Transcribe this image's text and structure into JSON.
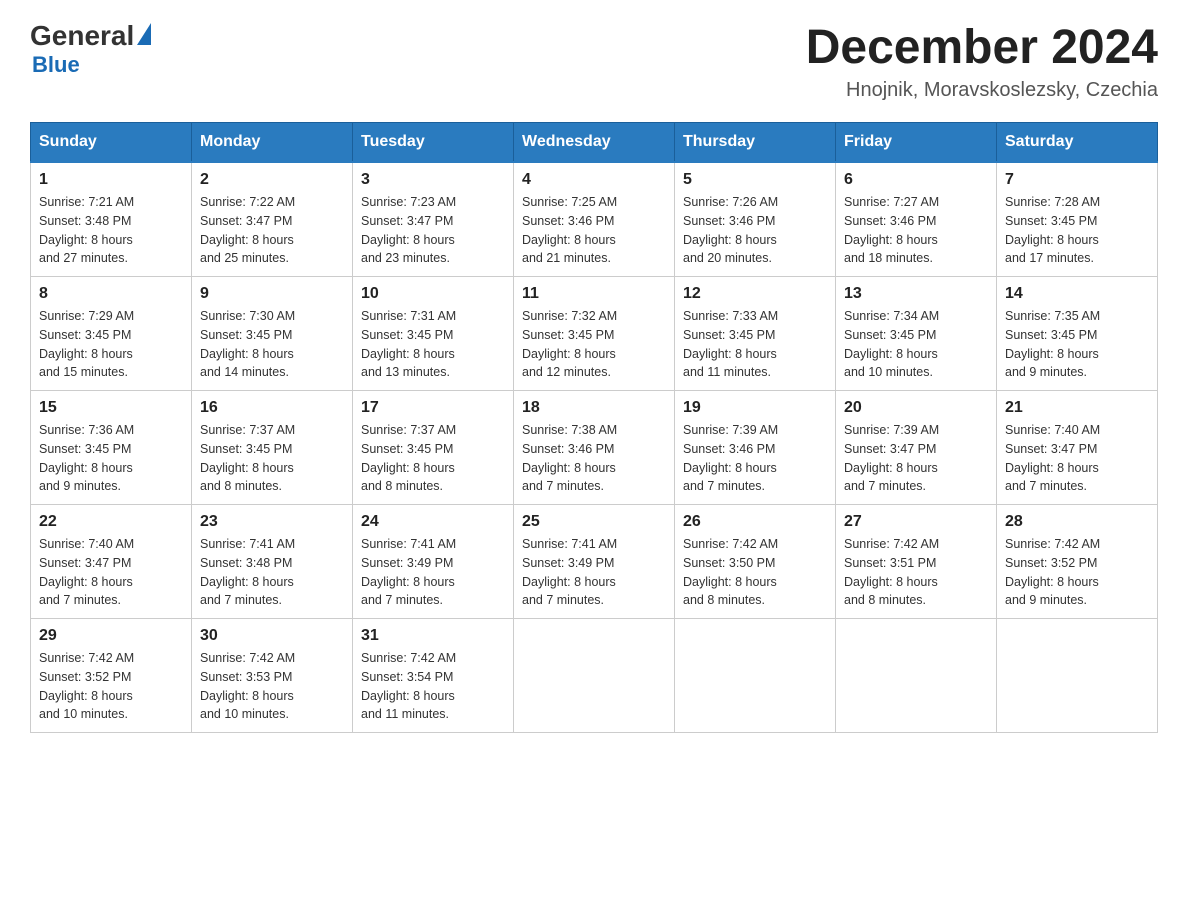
{
  "header": {
    "logo": {
      "general": "General",
      "blue": "Blue"
    },
    "title": "December 2024",
    "location": "Hnojnik, Moravskoslezsky, Czechia"
  },
  "weekdays": [
    "Sunday",
    "Monday",
    "Tuesday",
    "Wednesday",
    "Thursday",
    "Friday",
    "Saturday"
  ],
  "weeks": [
    [
      {
        "day": "1",
        "sunrise": "7:21 AM",
        "sunset": "3:48 PM",
        "daylight": "8 hours and 27 minutes."
      },
      {
        "day": "2",
        "sunrise": "7:22 AM",
        "sunset": "3:47 PM",
        "daylight": "8 hours and 25 minutes."
      },
      {
        "day": "3",
        "sunrise": "7:23 AM",
        "sunset": "3:47 PM",
        "daylight": "8 hours and 23 minutes."
      },
      {
        "day": "4",
        "sunrise": "7:25 AM",
        "sunset": "3:46 PM",
        "daylight": "8 hours and 21 minutes."
      },
      {
        "day": "5",
        "sunrise": "7:26 AM",
        "sunset": "3:46 PM",
        "daylight": "8 hours and 20 minutes."
      },
      {
        "day": "6",
        "sunrise": "7:27 AM",
        "sunset": "3:46 PM",
        "daylight": "8 hours and 18 minutes."
      },
      {
        "day": "7",
        "sunrise": "7:28 AM",
        "sunset": "3:45 PM",
        "daylight": "8 hours and 17 minutes."
      }
    ],
    [
      {
        "day": "8",
        "sunrise": "7:29 AM",
        "sunset": "3:45 PM",
        "daylight": "8 hours and 15 minutes."
      },
      {
        "day": "9",
        "sunrise": "7:30 AM",
        "sunset": "3:45 PM",
        "daylight": "8 hours and 14 minutes."
      },
      {
        "day": "10",
        "sunrise": "7:31 AM",
        "sunset": "3:45 PM",
        "daylight": "8 hours and 13 minutes."
      },
      {
        "day": "11",
        "sunrise": "7:32 AM",
        "sunset": "3:45 PM",
        "daylight": "8 hours and 12 minutes."
      },
      {
        "day": "12",
        "sunrise": "7:33 AM",
        "sunset": "3:45 PM",
        "daylight": "8 hours and 11 minutes."
      },
      {
        "day": "13",
        "sunrise": "7:34 AM",
        "sunset": "3:45 PM",
        "daylight": "8 hours and 10 minutes."
      },
      {
        "day": "14",
        "sunrise": "7:35 AM",
        "sunset": "3:45 PM",
        "daylight": "8 hours and 9 minutes."
      }
    ],
    [
      {
        "day": "15",
        "sunrise": "7:36 AM",
        "sunset": "3:45 PM",
        "daylight": "8 hours and 9 minutes."
      },
      {
        "day": "16",
        "sunrise": "7:37 AM",
        "sunset": "3:45 PM",
        "daylight": "8 hours and 8 minutes."
      },
      {
        "day": "17",
        "sunrise": "7:37 AM",
        "sunset": "3:45 PM",
        "daylight": "8 hours and 8 minutes."
      },
      {
        "day": "18",
        "sunrise": "7:38 AM",
        "sunset": "3:46 PM",
        "daylight": "8 hours and 7 minutes."
      },
      {
        "day": "19",
        "sunrise": "7:39 AM",
        "sunset": "3:46 PM",
        "daylight": "8 hours and 7 minutes."
      },
      {
        "day": "20",
        "sunrise": "7:39 AM",
        "sunset": "3:47 PM",
        "daylight": "8 hours and 7 minutes."
      },
      {
        "day": "21",
        "sunrise": "7:40 AM",
        "sunset": "3:47 PM",
        "daylight": "8 hours and 7 minutes."
      }
    ],
    [
      {
        "day": "22",
        "sunrise": "7:40 AM",
        "sunset": "3:47 PM",
        "daylight": "8 hours and 7 minutes."
      },
      {
        "day": "23",
        "sunrise": "7:41 AM",
        "sunset": "3:48 PM",
        "daylight": "8 hours and 7 minutes."
      },
      {
        "day": "24",
        "sunrise": "7:41 AM",
        "sunset": "3:49 PM",
        "daylight": "8 hours and 7 minutes."
      },
      {
        "day": "25",
        "sunrise": "7:41 AM",
        "sunset": "3:49 PM",
        "daylight": "8 hours and 7 minutes."
      },
      {
        "day": "26",
        "sunrise": "7:42 AM",
        "sunset": "3:50 PM",
        "daylight": "8 hours and 8 minutes."
      },
      {
        "day": "27",
        "sunrise": "7:42 AM",
        "sunset": "3:51 PM",
        "daylight": "8 hours and 8 minutes."
      },
      {
        "day": "28",
        "sunrise": "7:42 AM",
        "sunset": "3:52 PM",
        "daylight": "8 hours and 9 minutes."
      }
    ],
    [
      {
        "day": "29",
        "sunrise": "7:42 AM",
        "sunset": "3:52 PM",
        "daylight": "8 hours and 10 minutes."
      },
      {
        "day": "30",
        "sunrise": "7:42 AM",
        "sunset": "3:53 PM",
        "daylight": "8 hours and 10 minutes."
      },
      {
        "day": "31",
        "sunrise": "7:42 AM",
        "sunset": "3:54 PM",
        "daylight": "8 hours and 11 minutes."
      },
      null,
      null,
      null,
      null
    ]
  ]
}
